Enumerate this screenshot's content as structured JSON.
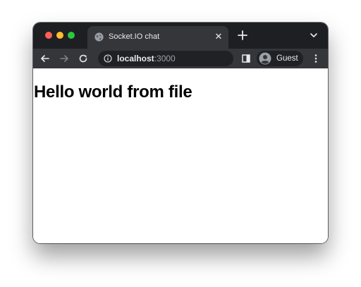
{
  "colors": {
    "titlebar": "#1e1f22",
    "toolbar": "#35363a",
    "omnibox": "#202124",
    "close": "#ff5f57",
    "minimize": "#febc2e",
    "maximize": "#28c840"
  },
  "tab": {
    "title": "Socket.IO chat",
    "favicon": "globe-icon"
  },
  "toolbar": {
    "url_host": "localhost",
    "url_port": ":3000",
    "profile_name": "Guest"
  },
  "page": {
    "heading": "Hello world from file"
  }
}
